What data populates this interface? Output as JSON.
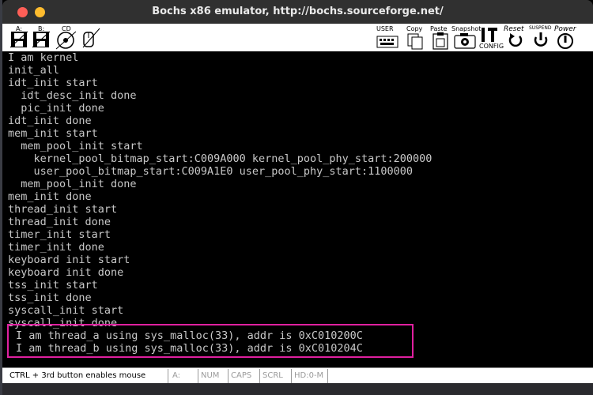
{
  "window": {
    "title": "Bochs x86 emulator, http://bochs.sourceforge.net/"
  },
  "toolbar": {
    "floppy_a": "A:",
    "floppy_b": "B:",
    "cdrom": "CD",
    "user": "USER",
    "copy": "Copy",
    "paste": "Paste",
    "snapshot": "Snapshot",
    "config": "CONFIG",
    "reset": "Reset",
    "suspend": "SUSPEND",
    "power": "Power"
  },
  "console": {
    "lines": [
      "I am kernel",
      "init_all",
      "idt_init start",
      "  idt_desc_init done",
      "  pic_init done",
      "idt_init done",
      "mem_init start",
      "  mem_pool_init start",
      "    kernel_pool_bitmap_start:C009A000 kernel_pool_phy_start:200000",
      "    user_pool_bitmap_start:C009A1E0 user_pool_phy_start:1100000",
      "  mem_pool_init done",
      "mem_init done",
      "thread_init start",
      "thread_init done",
      "timer_init start",
      "timer_init done",
      "keyboard init start",
      "keyboard init done",
      "tss_init start",
      "tss_init done",
      "syscall_init start",
      "syscall_init done",
      "I am thread_a using sys_malloc(33), addr is 0xC010200C",
      "I am thread_b using sys_malloc(33), addr is 0xC010204C"
    ],
    "text_color": "#c8c8c8",
    "highlight_color": "#e020a0"
  },
  "status": {
    "hint": "CTRL + 3rd button enables mouse",
    "drive": "A:",
    "num": "NUM",
    "caps": "CAPS",
    "scrl": "SCRL",
    "hd": "HD:0-M"
  }
}
